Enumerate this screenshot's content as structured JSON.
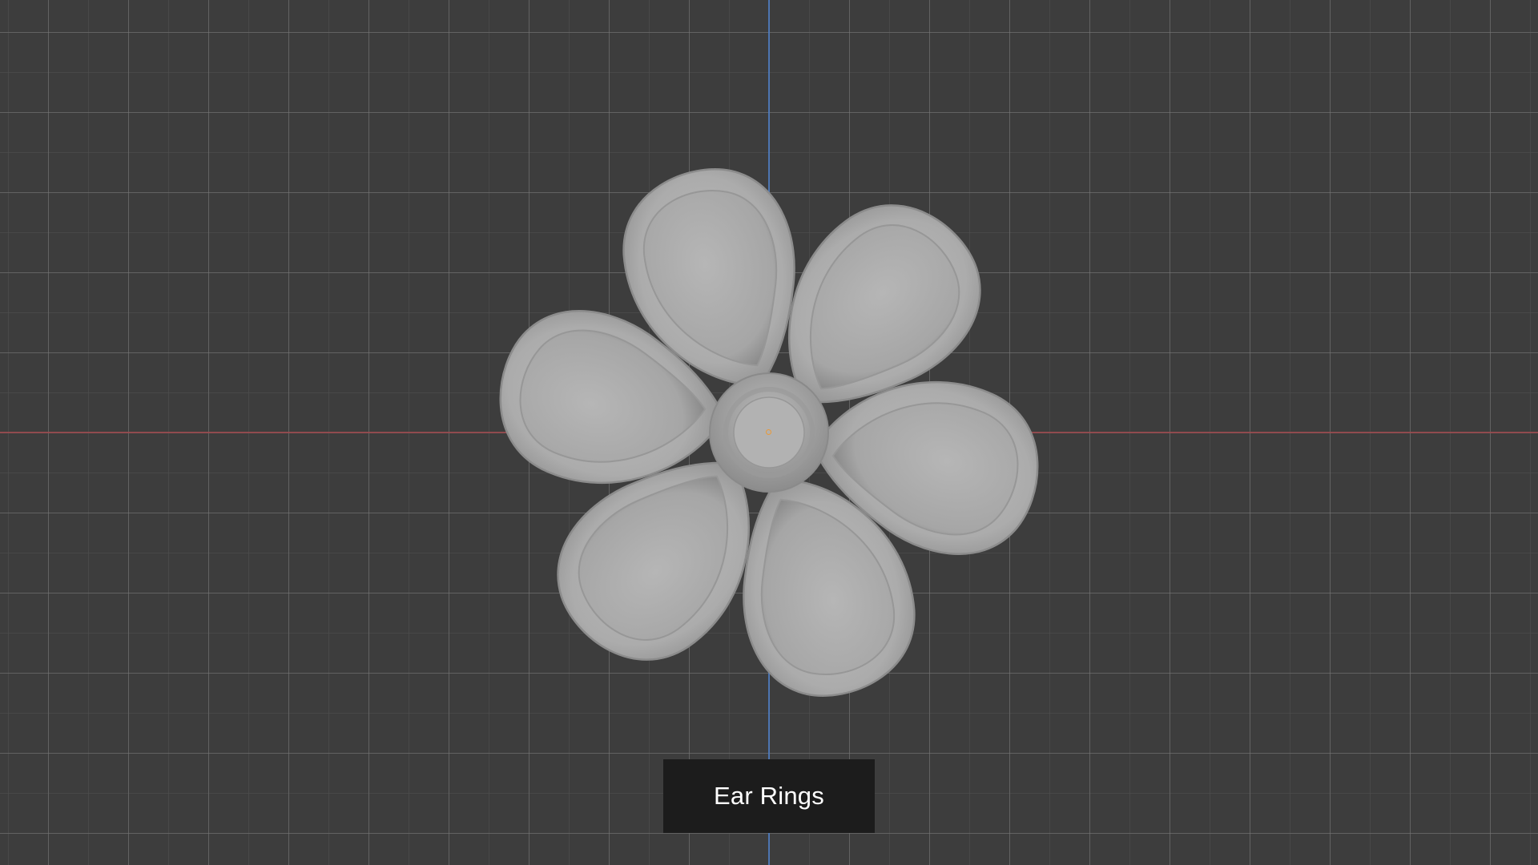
{
  "viewport": {
    "background_color": "#3d3d3d",
    "grid_color": "#787878",
    "x_axis_color": "#9c4a4f",
    "y_axis_color": "#4d7cc2",
    "origin_marker_color": "#e89a3a"
  },
  "model": {
    "surface_color": "#b4b4b4",
    "petal_count": 6
  },
  "caption": {
    "text": "Ear Rings",
    "background": "#1c1c1c",
    "text_color": "#ffffff"
  }
}
